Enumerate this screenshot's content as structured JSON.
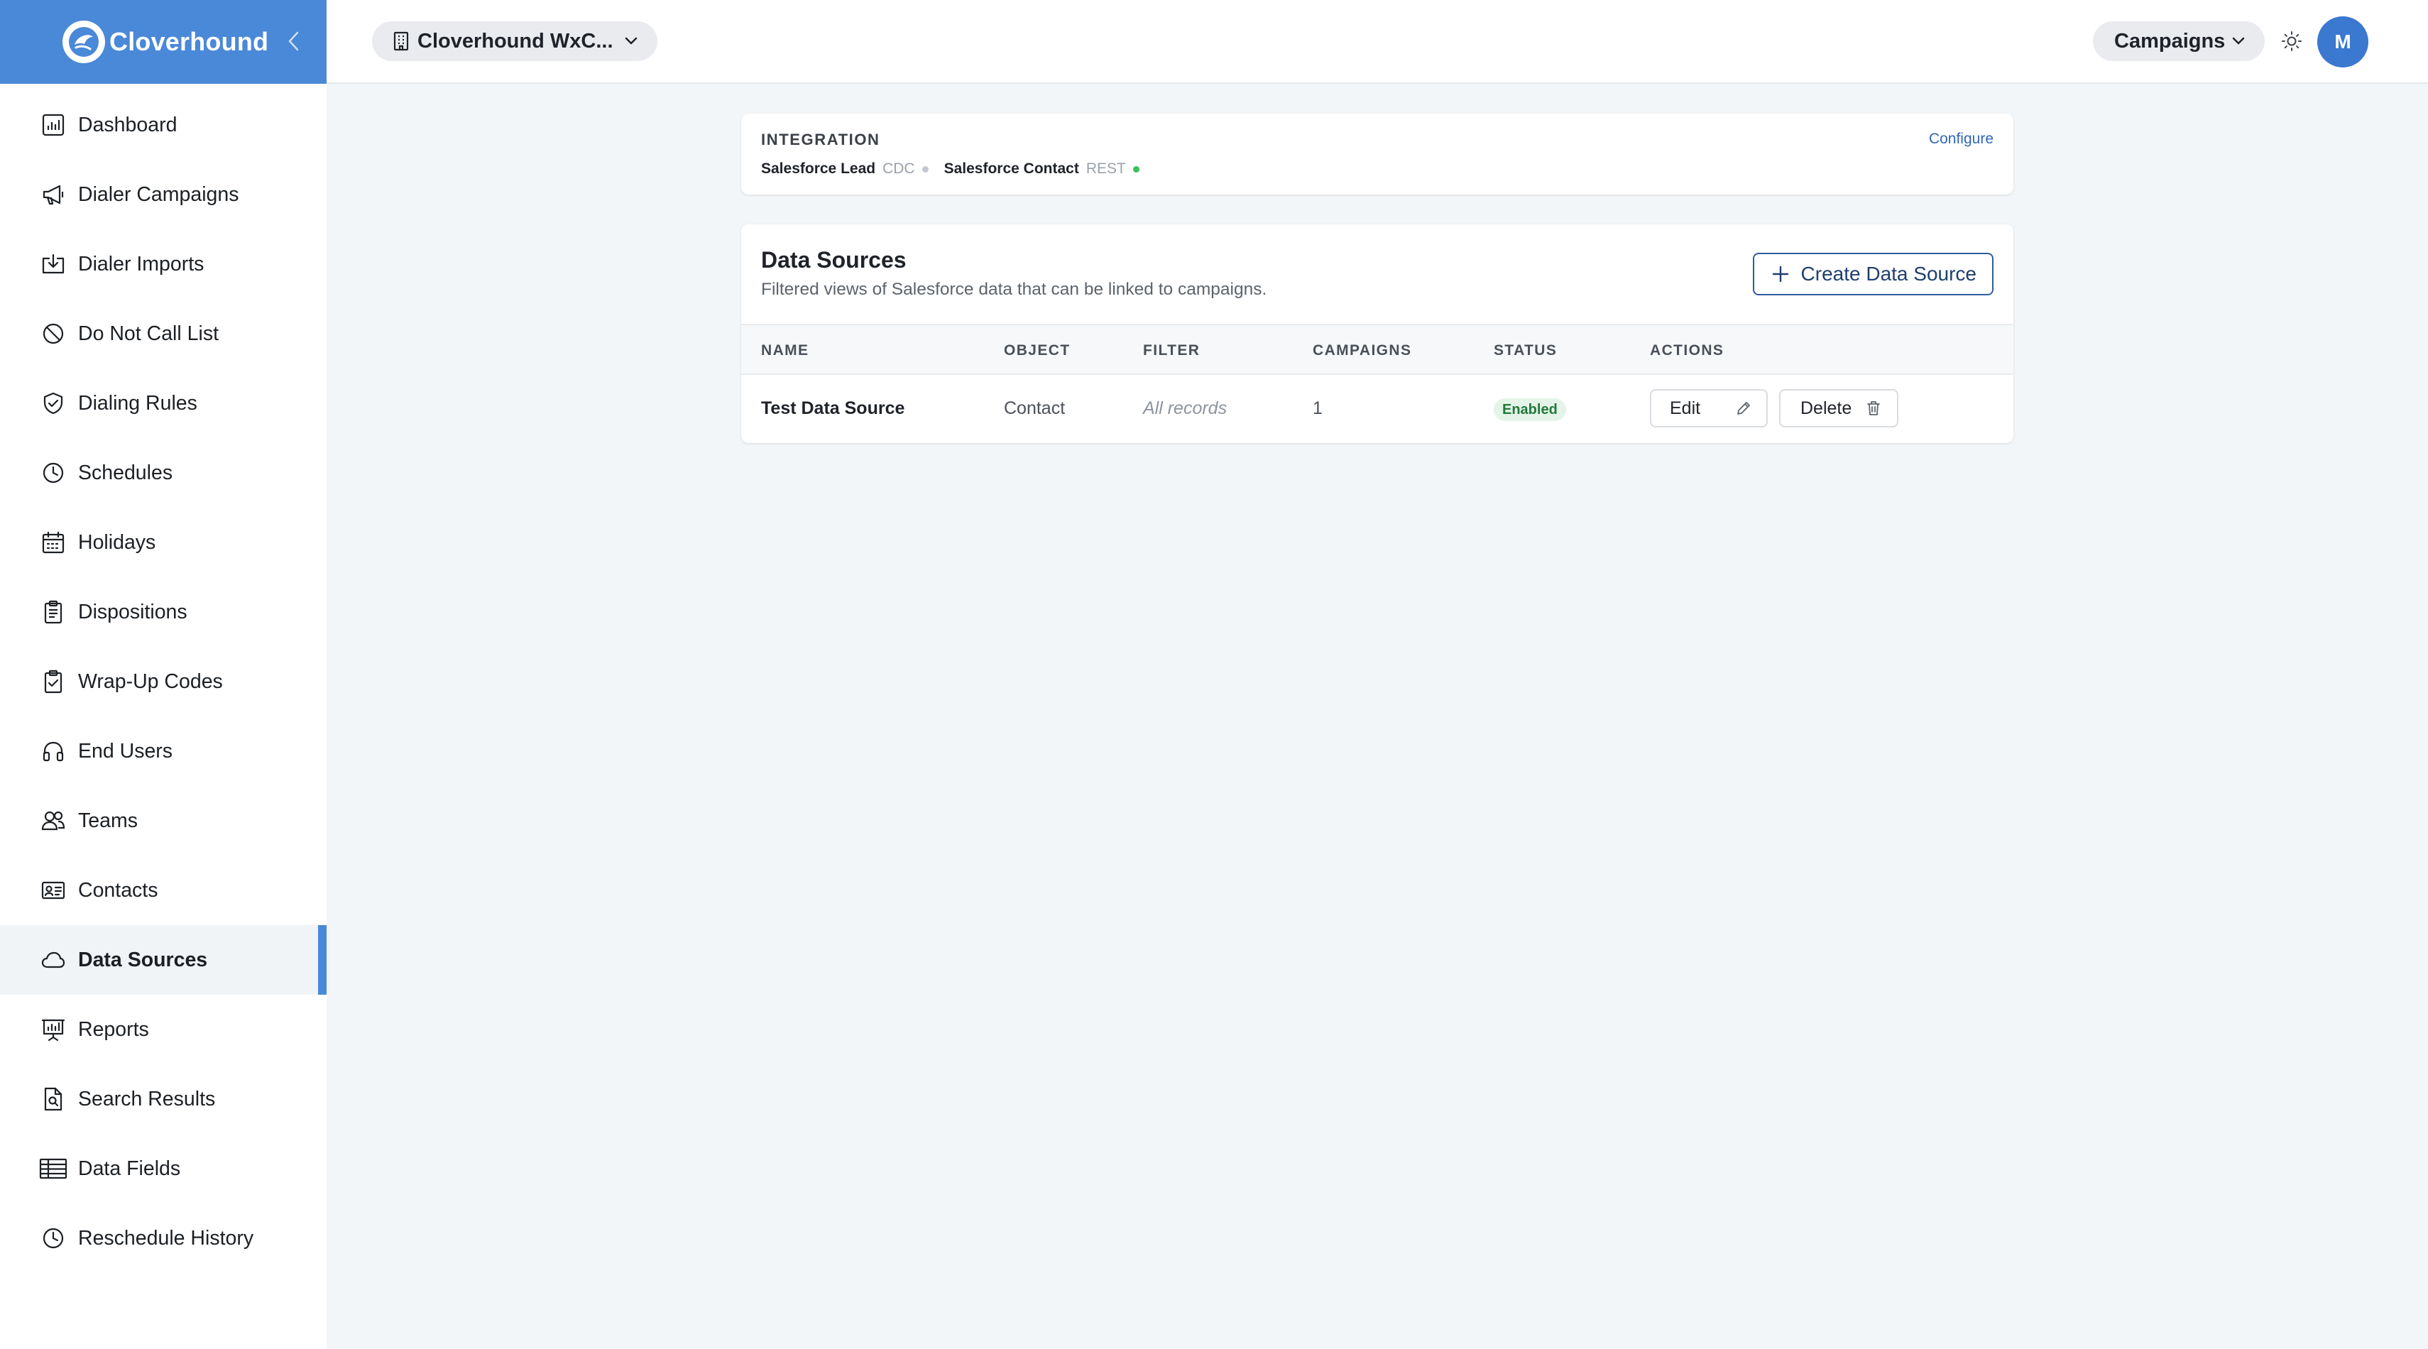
{
  "brand": {
    "name": "Cloverhound"
  },
  "sidebar": {
    "items": [
      {
        "label": "Dashboard",
        "icon": "dashboard-icon"
      },
      {
        "label": "Dialer Campaigns",
        "icon": "megaphone-icon"
      },
      {
        "label": "Dialer Imports",
        "icon": "import-icon"
      },
      {
        "label": "Do Not Call List",
        "icon": "prohibited-icon"
      },
      {
        "label": "Dialing Rules",
        "icon": "shield-check-icon"
      },
      {
        "label": "Schedules",
        "icon": "clock-icon"
      },
      {
        "label": "Holidays",
        "icon": "calendar-icon"
      },
      {
        "label": "Dispositions",
        "icon": "clipboard-icon"
      },
      {
        "label": "Wrap-Up Codes",
        "icon": "clipboard-check-icon"
      },
      {
        "label": "End Users",
        "icon": "headset-icon"
      },
      {
        "label": "Teams",
        "icon": "users-icon"
      },
      {
        "label": "Contacts",
        "icon": "contact-card-icon"
      },
      {
        "label": "Data Sources",
        "icon": "cloud-icon",
        "active": true
      },
      {
        "label": "Reports",
        "icon": "presentation-chart-icon"
      },
      {
        "label": "Search Results",
        "icon": "document-search-icon"
      },
      {
        "label": "Data Fields",
        "icon": "table-icon"
      },
      {
        "label": "Reschedule History",
        "icon": "clock-icon"
      }
    ]
  },
  "topbar": {
    "org_label": "Cloverhound WxC...",
    "module_label": "Campaigns",
    "avatar_initial": "M"
  },
  "integration": {
    "title": "INTEGRATION",
    "configure_label": "Configure",
    "items": [
      {
        "name": "Salesforce Lead",
        "type": "CDC",
        "status_color": "#c4c9cf"
      },
      {
        "name": "Salesforce Contact",
        "type": "REST",
        "status_color": "#3cbf5a"
      }
    ]
  },
  "data_sources": {
    "title": "Data Sources",
    "subtitle": "Filtered views of Salesforce data that can be linked to campaigns.",
    "create_label": "Create Data Source",
    "columns": [
      "NAME",
      "OBJECT",
      "FILTER",
      "CAMPAIGNS",
      "STATUS",
      "ACTIONS"
    ],
    "rows": [
      {
        "name": "Test Data Source",
        "object": "Contact",
        "filter": "All records",
        "campaigns": "1",
        "status": "Enabled",
        "edit_label": "Edit",
        "delete_label": "Delete"
      }
    ]
  },
  "colors": {
    "brand_blue": "#4a88d8",
    "status_enabled_bg": "#e5f4e8",
    "status_enabled_text": "#217a3a",
    "link": "#2e68b8"
  }
}
